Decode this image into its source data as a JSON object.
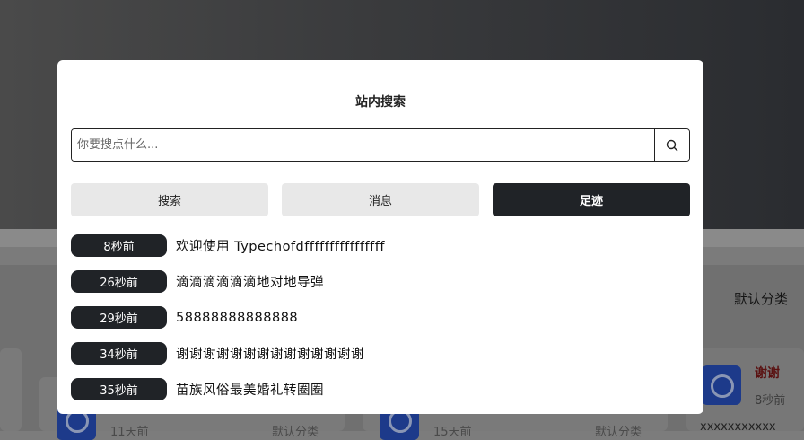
{
  "background": {
    "category_label": "默认分类",
    "card_times": [
      "11天前",
      "15天前"
    ],
    "card_categories": [
      "默认分类",
      "默认分类"
    ],
    "side_card": {
      "name": "谢谢",
      "time": "8秒前",
      "text": "xxxxxxxxxxx"
    }
  },
  "modal": {
    "title": "站内搜索",
    "search": {
      "placeholder": "你要搜点什么...",
      "value": ""
    },
    "tabs": [
      {
        "label": "搜索",
        "active": false
      },
      {
        "label": "消息",
        "active": false
      },
      {
        "label": "足迹",
        "active": true
      }
    ],
    "history": [
      {
        "time": "8秒前",
        "text": "欢迎使用 Typechofdffffffffffffffff"
      },
      {
        "time": "26秒前",
        "text": "滴滴滴滴滴滴地对地导弹"
      },
      {
        "time": "29秒前",
        "text": "58888888888888"
      },
      {
        "time": "34秒前",
        "text": "谢谢谢谢谢谢谢谢谢谢谢谢谢谢"
      },
      {
        "time": "35秒前",
        "text": "苗族风俗最美婚礼转圈圈"
      }
    ]
  },
  "colors": {
    "accent_dark": "#202327",
    "tab_inactive": "#e8e8e8",
    "overlay_bg": "#7c7c7c"
  }
}
